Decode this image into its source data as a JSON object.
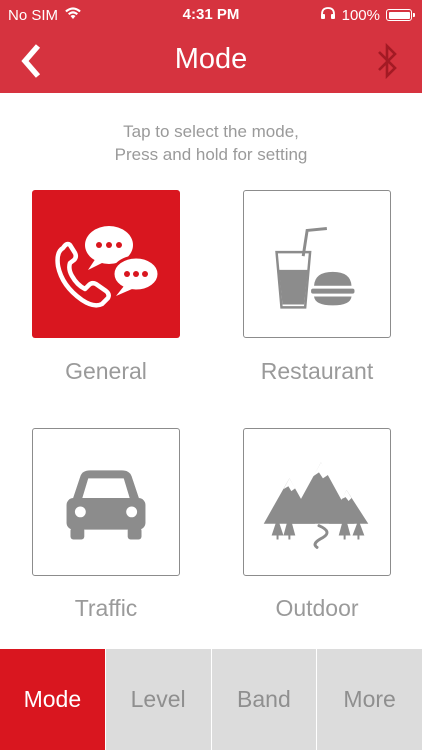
{
  "status_bar": {
    "carrier": "No SIM",
    "time": "4:31 PM",
    "battery": "100%",
    "battery_level": 1.0,
    "icons": [
      "wifi-icon",
      "headphones-icon",
      "battery-icon"
    ]
  },
  "nav": {
    "title": "Mode",
    "back_icon": "chevron-left-icon",
    "right_icon": "bluetooth-icon"
  },
  "instructions": {
    "line1": "Tap to select the mode,",
    "line2": "Press and hold for setting"
  },
  "modes": [
    {
      "label": "General",
      "icon": "phone-chat-icon",
      "selected": true
    },
    {
      "label": "Restaurant",
      "icon": "drink-burger-icon",
      "selected": false
    },
    {
      "label": "Traffic",
      "icon": "car-icon",
      "selected": false
    },
    {
      "label": "Outdoor",
      "icon": "mountains-icon",
      "selected": false
    }
  ],
  "tabs": [
    {
      "label": "Mode",
      "active": true
    },
    {
      "label": "Level",
      "active": false
    },
    {
      "label": "Band",
      "active": false
    },
    {
      "label": "More",
      "active": false
    }
  ],
  "colors": {
    "accent": "#d6333f",
    "active_tile": "#d9161f",
    "icon_gray": "#8c8c8c",
    "label_gray": "#9a9a9a",
    "tab_bg": "#dcdcdc"
  }
}
